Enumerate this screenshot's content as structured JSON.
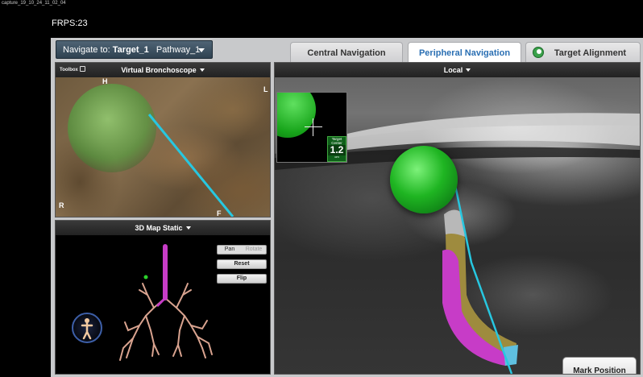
{
  "capture_label": "capture_19_10_24_11_02_04",
  "frps": "FRPS:23",
  "navigator": {
    "prefix": "Navigate to:",
    "target": "Target_1",
    "pathway": "Pathway_1"
  },
  "tabs": {
    "central": "Central Navigation",
    "peripheral": "Peripheral Navigation",
    "target": "Target Alignment",
    "active": "peripheral"
  },
  "virtual_bronchoscope": {
    "toolbox": "Toolbox",
    "title": "Virtual Bronchoscope",
    "directions": {
      "h": "H",
      "l": "L",
      "r": "R",
      "f": "F"
    }
  },
  "map3d": {
    "title": "3D Map Static",
    "pan": "Pan",
    "rotate": "Rotate",
    "reset": "Reset",
    "flip": "Flip"
  },
  "local": {
    "title": "Local",
    "target_label_line1": "Target",
    "target_label_line2": "Center",
    "target_distance": "1.2",
    "target_unit": "cm",
    "mark_position": "Mark Position"
  },
  "colors": {
    "tool_line": "#27c7e0",
    "target_green": "#1fb522",
    "active_tab_text": "#2a6fb3",
    "catheter_magenta": "#c73cc7"
  }
}
